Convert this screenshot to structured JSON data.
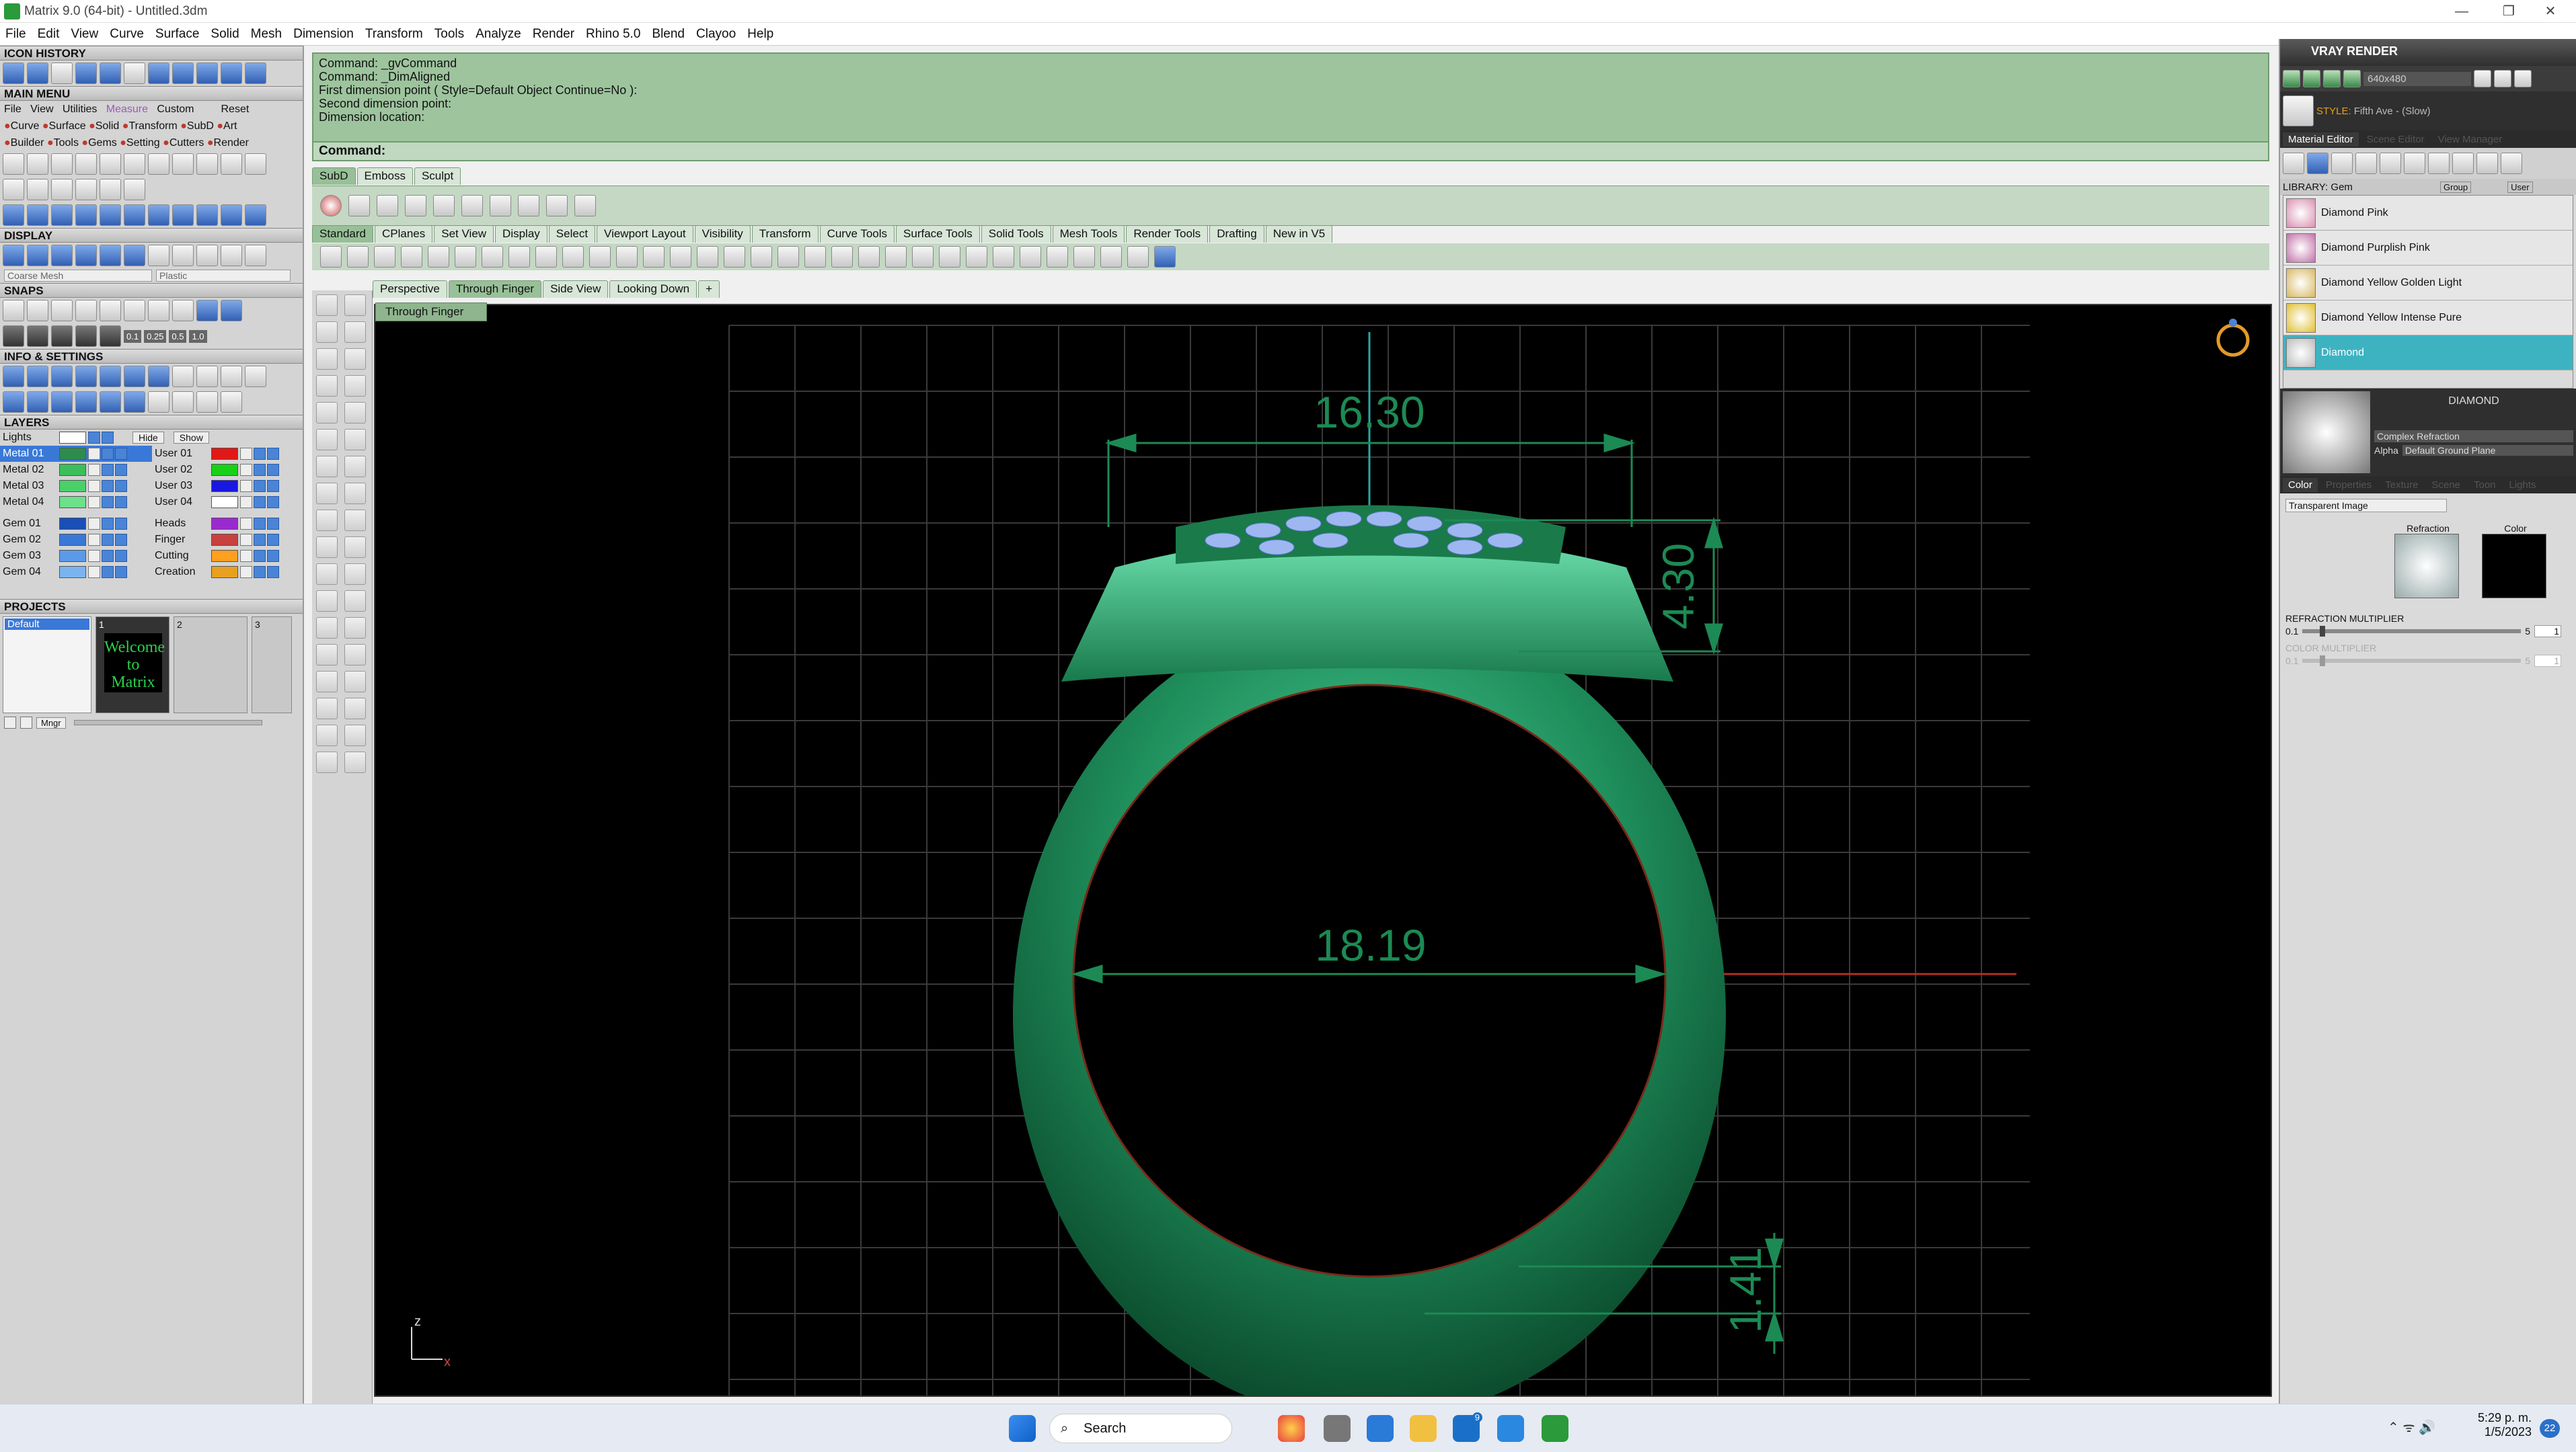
{
  "titlebar": {
    "title": "Matrix 9.0 (64-bit) - Untitled.3dm",
    "minimize": "—",
    "maximize": "❐",
    "close": "✕"
  },
  "menubar": [
    "File",
    "Edit",
    "View",
    "Curve",
    "Surface",
    "Solid",
    "Mesh",
    "Dimension",
    "Transform",
    "Tools",
    "Analyze",
    "Render",
    "Rhino 5.0",
    "Blend",
    "Clayoo",
    "Help"
  ],
  "left": {
    "icon_history": "ICON HISTORY",
    "main_menu": "MAIN MENU",
    "mm_row1": [
      "File",
      "View",
      "Utilities",
      "Measure",
      "Custom",
      "Reset"
    ],
    "mm_row2": [
      "Curve",
      "Surface",
      "Solid",
      "Transform",
      "SubD",
      "Art"
    ],
    "mm_row3": [
      "Builder",
      "Tools",
      "Gems",
      "Setting",
      "Cutters",
      "Render"
    ],
    "display": "DISPLAY",
    "display_mesh": "Coarse Mesh",
    "display_mat": "Plastic",
    "snaps": "SNAPS",
    "snap_values": [
      "0.1",
      "0.25",
      "0.5",
      "1.0"
    ],
    "info": "INFO & SETTINGS",
    "layers": "LAYERS",
    "layers_lights": "Lights",
    "layers_hide": "Hide",
    "layers_show": "Show",
    "layers_left": [
      {
        "name": "Metal 01",
        "color": "#2e8b4e"
      },
      {
        "name": "Metal 02",
        "color": "#3bbf5a"
      },
      {
        "name": "Metal 03",
        "color": "#4ad06a"
      },
      {
        "name": "Metal 04",
        "color": "#6ce08a"
      },
      {
        "name": "Gem 01",
        "color": "#1a4fb8"
      },
      {
        "name": "Gem 02",
        "color": "#3a78d8"
      },
      {
        "name": "Gem 03",
        "color": "#5b9ae8"
      },
      {
        "name": "Gem 04",
        "color": "#7ab4f0"
      }
    ],
    "layers_right": [
      {
        "name": "User 01",
        "color": "#e01818"
      },
      {
        "name": "User 02",
        "color": "#18d018"
      },
      {
        "name": "User 03",
        "color": "#1818e0"
      },
      {
        "name": "User 04",
        "color": "#ffffff"
      },
      {
        "name": "Heads",
        "color": "#9a2ad0"
      },
      {
        "name": "Finger",
        "color": "#c84040"
      },
      {
        "name": "Cutting",
        "color": "#ffa020"
      },
      {
        "name": "Creation",
        "color": "#e8a020"
      }
    ],
    "projects": "PROJECTS",
    "project_default": "Default",
    "project_slots": [
      "1",
      "2",
      "3"
    ],
    "welcome": "Welcome to Matrix",
    "mngr": "Mngr"
  },
  "command": {
    "lines": [
      "Command: _gvCommand",
      "Command: _DimAligned",
      "First dimension point ( Style=Default  Object  Continue=No ):",
      "Second dimension point:",
      "Dimension location:"
    ],
    "prompt": "Command:"
  },
  "tabs1": [
    "SubD",
    "Emboss",
    "Sculpt"
  ],
  "tabs2": [
    "Standard",
    "CPlanes",
    "Set View",
    "Display",
    "Select",
    "Viewport Layout",
    "Visibility",
    "Transform",
    "Curve Tools",
    "Surface Tools",
    "Solid Tools",
    "Mesh Tools",
    "Render Tools",
    "Drafting",
    "New in V5"
  ],
  "viewtabs": [
    "Perspective",
    "Through Finger",
    "Side View",
    "Looking Down"
  ],
  "viewtab_add": "+",
  "view_sub": "Through Finger",
  "dims": {
    "top_width": "16.30",
    "height": "4.30",
    "inner": "18.19",
    "bottom": "1.41"
  },
  "axis": {
    "z": "z",
    "x": "x"
  },
  "right": {
    "header": "VRAY RENDER",
    "resolution": "640x480",
    "style_label": "STYLE:",
    "style": "Fifth Ave - (Slow)",
    "tabs": [
      "Material Editor",
      "Scene Editor",
      "View Manager"
    ],
    "library_label": "LIBRARY: Gem",
    "group_label": "Group",
    "user_label": "User",
    "materials": [
      "Diamond Pink",
      "Diamond Purplish Pink",
      "Diamond Yellow Golden Light",
      "Diamond Yellow Intense Pure",
      "Diamond"
    ],
    "selected_material": "DIAMOND",
    "complex": "Complex Refraction",
    "alpha": "Alpha",
    "ground": "Default Ground Plane",
    "subtabs": [
      "Color",
      "Properties",
      "Texture",
      "Scene",
      "Toon",
      "Lights"
    ],
    "transparent": "Transparent Image",
    "refraction": "Refraction",
    "color": "Color",
    "refr_mult": "REFRACTION MULTIPLIER",
    "refr_min": "0.1",
    "refr_max": "5",
    "refr_val": "1",
    "color_mult": "COLOR MULTIPLIER",
    "color_min": "0.1",
    "color_max": "5",
    "color_val": "1"
  },
  "taskbar": {
    "search": "Search",
    "time": "5:29 p. m.",
    "date": "1/5/2023",
    "notif": "22",
    "mail_badge": "9"
  },
  "colors": {
    "viewport_bg": "#000000",
    "ring": "#1f8f5c",
    "dimension": "#1c8a54",
    "grid": "#3a3a3a",
    "command_bg": "#9ec49e",
    "selected_material": "#3db3c2"
  }
}
